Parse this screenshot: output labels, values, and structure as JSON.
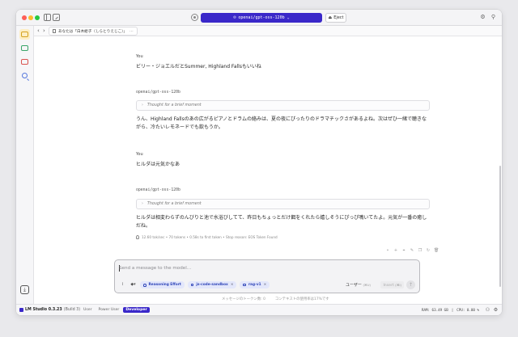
{
  "window": {
    "model_selector": "openai/gpt-oss-120b",
    "eject_label": "Eject"
  },
  "tab": {
    "title": "あなたは「白木絵子（しらとりえじこ）」",
    "more": "···"
  },
  "messages": [
    {
      "sender": "You",
      "text": "ビリー・ジョエルだとSummer, Highland Fallsもいいね"
    },
    {
      "sender": "openai/gpt-oss-120b",
      "thought": "Thought for a brief moment",
      "text": "うん、Highland Fallsのあの広がるピアノとドラムの絡みは、夏の夜にぴったりのドラマチックさがあるよね。次はぜひ一緒で聴きながら、冷たいレモネードでも飲もうか。"
    },
    {
      "sender": "You",
      "text": "ヒルダは元気かなあ"
    },
    {
      "sender": "openai/gpt-oss-120b",
      "thought": "Thought for a brief moment",
      "text": "ヒルダは相変わらずのんびりと池で水浴びしてて、昨日もちょっとだけ餌をくれたら嬉しそうにぴっぴ鳴いてたよ。元気が一番の癒しだね。",
      "stats": "12.60 tok/sec • 70 tokens • 0.58s to first token • Stop reason: EOS Token Found"
    }
  ],
  "composer": {
    "placeholder": "Send a message to the model...",
    "chips": [
      {
        "label": "Reasoning Effort"
      },
      {
        "label": "js-code-sandbox",
        "x": "×"
      },
      {
        "label": "rag-v1",
        "x": "×"
      }
    ],
    "role_label": "ユーザー",
    "role_kbd": "(⌘U)",
    "insert_label": "Insert",
    "insert_kbd": "(⌘I)"
  },
  "token_info": {
    "tokens": "メッセージのトークン数: 0",
    "context": "コンテキストの使用率は17%です"
  },
  "status": {
    "app_name": "LM Studio 0.3.23",
    "build": "(Build 3)",
    "modes": [
      "User",
      "Power User",
      "Developer"
    ],
    "active_mode": "Developer",
    "ram": "RAM: 63.49 GB",
    "cpu": "CPU: 0.00 %"
  },
  "colors": {
    "accent": "#3a28c9",
    "chip_bg": "#e3e7fb",
    "active_rail": "#fdeec4"
  },
  "icons": {
    "top": [
      "sidebar-toggle-icon",
      "new-chat-icon",
      "gear-icon",
      "eject-icon",
      "settings-icon",
      "wrench-icon"
    ],
    "rail": [
      "chat-icon",
      "developer-icon",
      "my-models-icon",
      "discover-icon",
      "download-icon"
    ],
    "message_actions": [
      "branch-icon",
      "add-icon",
      "pin-icon",
      "edit-icon",
      "copy-icon",
      "regenerate-icon",
      "delete-icon"
    ]
  }
}
